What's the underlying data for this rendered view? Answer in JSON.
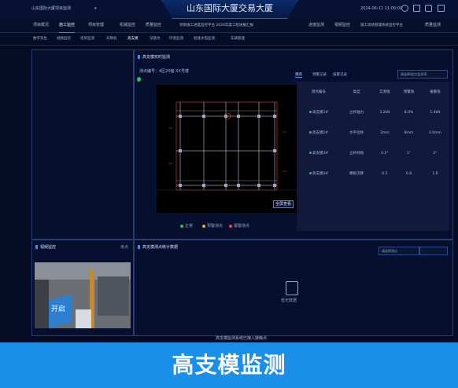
{
  "app": {
    "project_selector": "山东国际大厦项目监测",
    "title": "山东国际大厦交易大厦",
    "datetime": "2024-06-11 11:00:00"
  },
  "nav": {
    "left": [
      "项目概况",
      "施工监控",
      "项目管理",
      "机械监控",
      "质量监控"
    ],
    "center_notice": "项目施工进度监控平台 2024年度工程进展汇报",
    "right": [
      "进度监测",
      "视频监控",
      "施工现场管理系统监控平台",
      "质量监测"
    ]
  },
  "subnav": [
    "数字孪生",
    "视频监控",
    "塔吊监测",
    "升降机",
    "高支模",
    "深基坑",
    "环境监测",
    "智能水电监测",
    "车辆管理"
  ],
  "main": {
    "title": "高支模实时监测",
    "subtitle": "测点编号：4区20轴 XX号楼",
    "tabs": [
      "测点",
      "预警记录",
      "报警记录"
    ],
    "dropdown": "请选择测点/监测项",
    "table_headers": [
      "测点编号",
      "类型",
      "实测值",
      "预警值",
      "报警值"
    ],
    "rows": [
      {
        "id": "高支模1#",
        "type": "立杆轴力",
        "value": "3.2kN",
        "warn": "8.0%",
        "alarm": "1.4kN"
      },
      {
        "id": "高支模2#",
        "type": "水平位移",
        "value": "2mm",
        "warn": "8mm",
        "alarm": "4.0mm"
      },
      {
        "id": "高支模3#",
        "type": "立杆倾角",
        "value": "0.2°",
        "warn": "1°",
        "alarm": "2°"
      },
      {
        "id": "高支模4#",
        "type": "模板沉降",
        "value": "0.5",
        "warn": "0.8",
        "alarm": "1.6"
      }
    ],
    "zoom_btn": "全屏查看",
    "legend": [
      "正常",
      "预警测点",
      "报警测点"
    ]
  },
  "camera": {
    "title": "视频监控",
    "tag": "未点",
    "panel_label": "开启"
  },
  "list": {
    "title": "高支模测点统计数据",
    "dropdown": "请选择测点",
    "empty_text": "暂无数据",
    "footer_note": "高支模监测系统已接入接触点"
  },
  "banner": {
    "text": "高支模监测"
  },
  "colors": {
    "ok": "#28c25a",
    "warn": "#e6b020",
    "alarm": "#e94a3a",
    "accent": "#1a8fe8"
  }
}
